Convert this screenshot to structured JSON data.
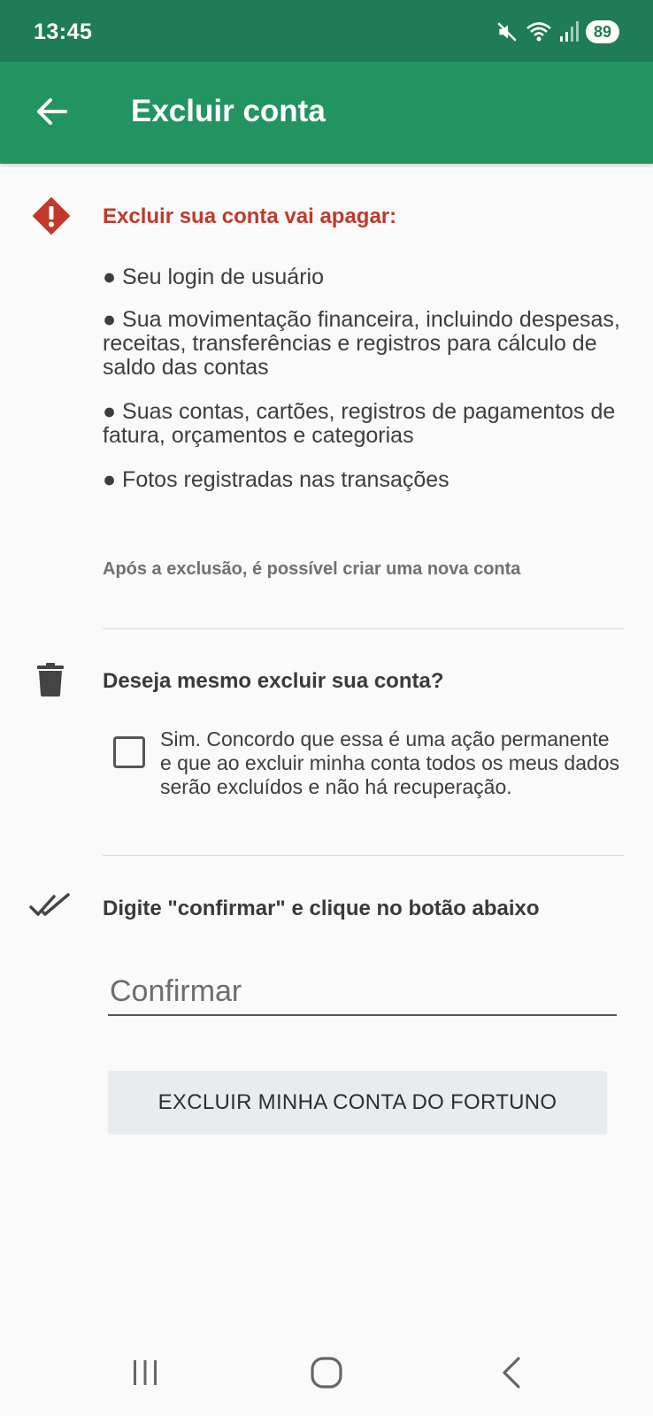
{
  "status_bar": {
    "time": "13:45",
    "battery": "89",
    "icons": [
      "mute-icon",
      "wifi-icon",
      "signal-icon",
      "battery-icon"
    ]
  },
  "app_bar": {
    "title": "Excluir conta",
    "back_icon": "arrow-left-icon"
  },
  "warning": {
    "icon": "warning-diamond-icon",
    "title": "Excluir sua conta vai apagar:",
    "items": [
      "● Seu login de usuário",
      "● Sua movimentação financeira, incluindo despesas, receitas, transferências e registros para cálculo de saldo das contas",
      "● Suas contas, cartões, registros de pagamentos de fatura, orçamentos e categorias",
      "● Fotos registradas nas transações"
    ],
    "note": "Após a exclusão, é possível criar uma nova conta"
  },
  "confirmation": {
    "icon": "trash-icon",
    "question": "Deseja mesmo excluir sua conta?",
    "checkbox_checked": false,
    "checkbox_label": "Sim. Concordo que essa é uma ação permanente e que ao excluir minha conta todos os meus dados serão excluídos e não há recuperação."
  },
  "type_confirm": {
    "icon": "double-check-icon",
    "instruction": "Digite \"confirmar\" e clique no botão abaixo",
    "input_placeholder": "Confirmar",
    "input_value": ""
  },
  "delete_button": {
    "label": "EXCLUIR MINHA CONTA DO FORTUNO"
  },
  "nav_bar": {
    "buttons": [
      "recent-apps-icon",
      "home-icon",
      "back-icon"
    ]
  },
  "colors": {
    "status_bar": "#1e7c57",
    "app_bar": "#229461",
    "warning_red": "#c0392b",
    "background": "#fafafa",
    "button_bg": "#e9ecee"
  }
}
